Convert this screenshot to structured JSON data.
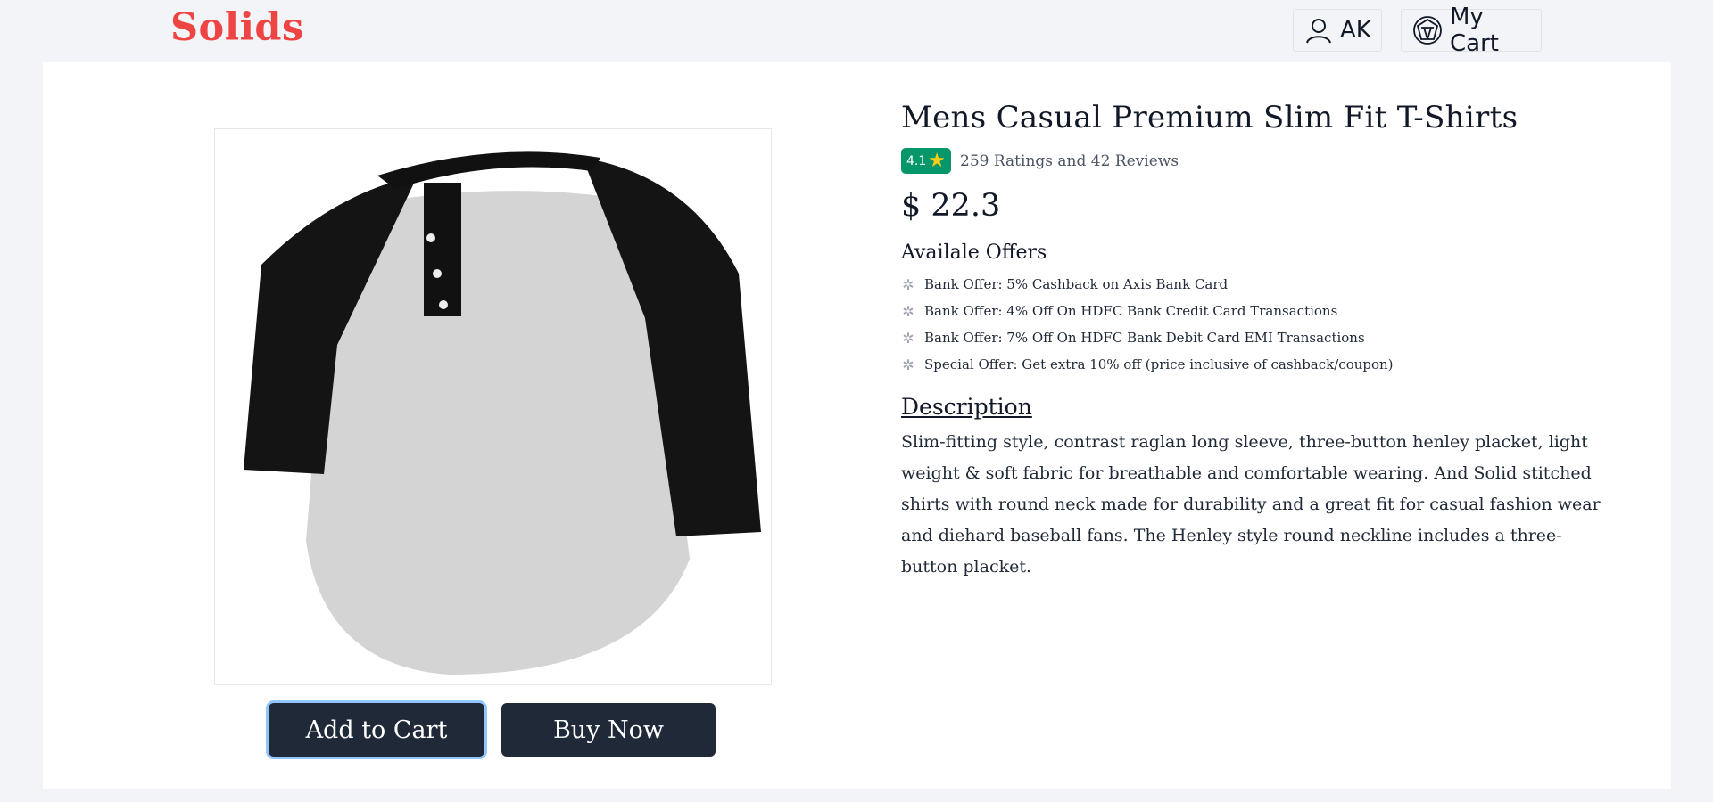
{
  "header": {
    "brand": "Solids",
    "user_label": "AK",
    "cart_label": "My Cart"
  },
  "product": {
    "title": "Mens Casual Premium Slim Fit T-Shirts",
    "rating": "4.1",
    "rating_text": "259 Ratings and 42 Reviews",
    "price": "$ 22.3",
    "offers_title": "Availale Offers",
    "offers": [
      "Bank Offer: 5% Cashback on Axis Bank Card",
      "Bank Offer: 4% Off On HDFC Bank Credit Card Transactions",
      "Bank Offer: 7% Off On HDFC Bank Debit Card EMI Transactions",
      "Special Offer: Get extra 10% off (price inclusive of cashback/coupon)"
    ],
    "description_title": "Description",
    "description": "Slim-fitting style, contrast raglan long sleeve, three-button henley placket, light weight & soft fabric for breathable and comfortable wearing. And Solid stitched shirts with round neck made for durability and a great fit for casual fashion wear and diehard baseball fans. The Henley style round neckline includes a three-button placket."
  },
  "actions": {
    "add_to_cart": "Add to Cart",
    "buy_now": "Buy Now"
  },
  "colors": {
    "brand": "#ef4444",
    "button_bg": "#1f2937",
    "rating_badge": "#059669",
    "background": "#f3f4f7"
  },
  "icons": {
    "user": "user-icon",
    "cart": "cart-icon",
    "star": "star-icon",
    "offer": "offer-icon"
  }
}
